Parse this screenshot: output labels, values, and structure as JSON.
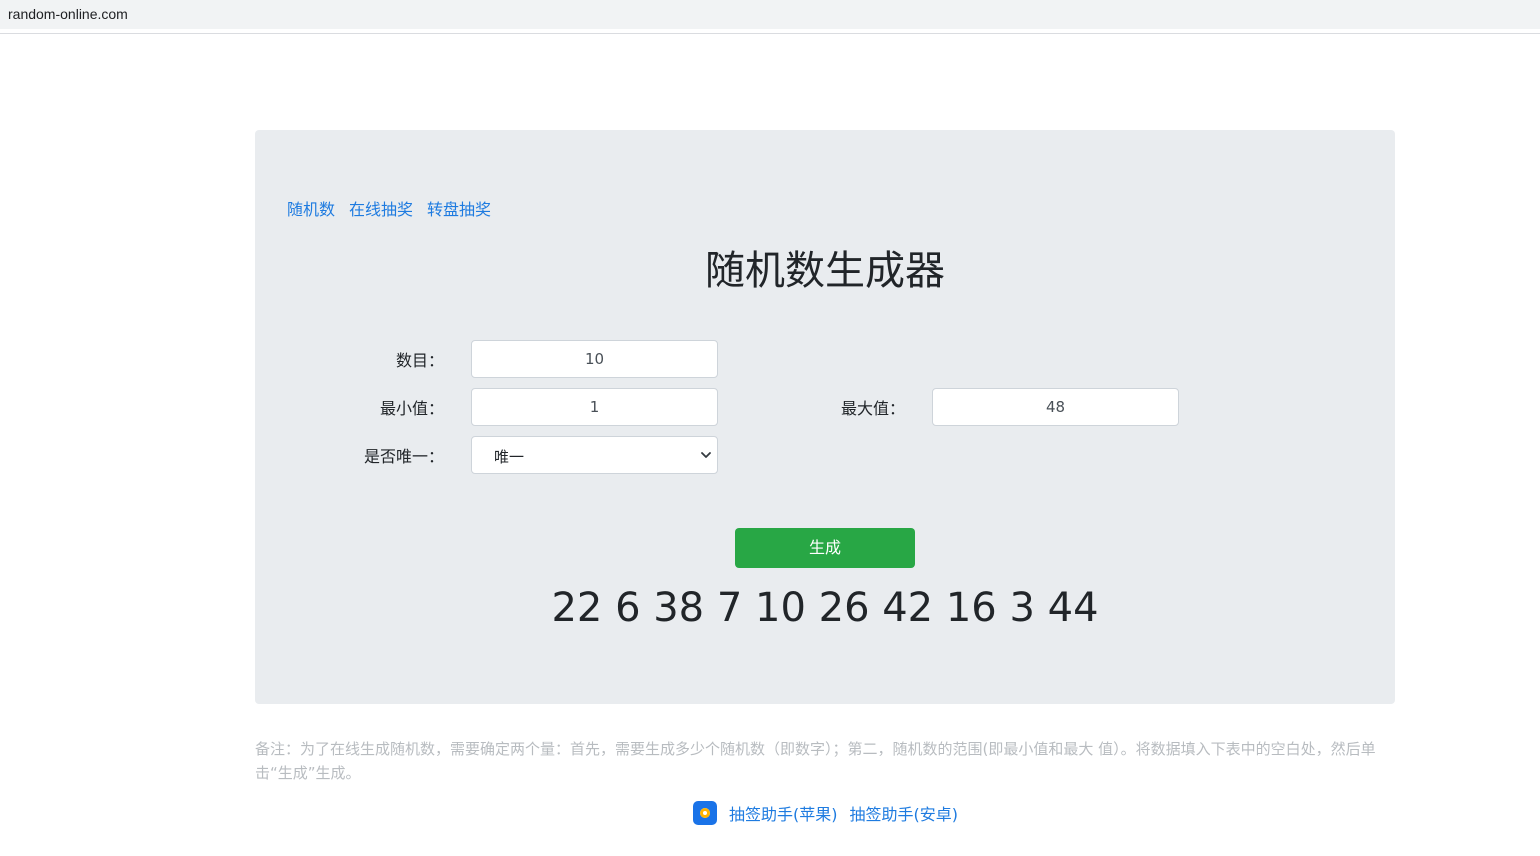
{
  "browser": {
    "url": "random-online.com"
  },
  "nav": {
    "items": [
      "随机数",
      "在线抽奖",
      "转盘抽奖"
    ]
  },
  "main": {
    "title": "随机数生成器",
    "count_label": "数目：",
    "count_value": "10",
    "min_label": "最小值：",
    "min_value": "1",
    "max_label": "最大值：",
    "max_value": "48",
    "unique_label": "是否唯一：",
    "unique_value": "唯一",
    "generate_label": "生成",
    "result": "22 6 38 7 10 26 42 16 3 44"
  },
  "note": "备注：为了在线生成随机数，需要确定两个量：首先，需要生成多少个随机数（即数字）；第二，随机数的范围(即最小值和最大 值）。将数据填入下表中的空白处，然后单击“生成”生成。",
  "footer": {
    "ios_link": "抽签助手(苹果)",
    "android_link": "抽签助手(安卓)"
  },
  "colors": {
    "link": "#1e7be0",
    "button": "#28a745",
    "panel": "#e9ecef"
  },
  "icons": {
    "app": "app-logo-icon",
    "dropdown": "chevron-down-icon"
  }
}
